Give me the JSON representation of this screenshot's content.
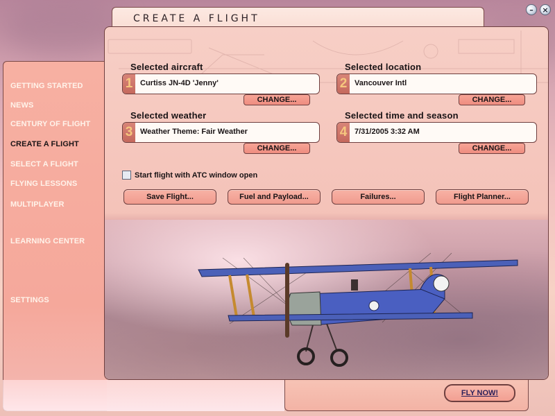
{
  "window": {
    "title": "CREATE A FLIGHT",
    "minimize_glyph": "–",
    "close_glyph": "×"
  },
  "nav": {
    "items": [
      {
        "label": "GETTING STARTED",
        "active": false
      },
      {
        "label": "NEWS",
        "active": false
      },
      {
        "label": "CENTURY OF FLIGHT",
        "active": false
      },
      {
        "label": "CREATE A FLIGHT",
        "active": true
      },
      {
        "label": "SELECT A FLIGHT",
        "active": false
      },
      {
        "label": "FLYING LESSONS",
        "active": false
      },
      {
        "label": "MULTIPLAYER",
        "active": false
      },
      {
        "label": "LEARNING CENTER",
        "active": false
      },
      {
        "label": "SETTINGS",
        "active": false
      }
    ]
  },
  "aircraft": {
    "label": "Selected aircraft",
    "number": "1",
    "value": "Curtiss JN-4D 'Jenny'",
    "change": "CHANGE..."
  },
  "location": {
    "label": "Selected location",
    "number": "2",
    "value": "Vancouver Intl",
    "change": "CHANGE..."
  },
  "weather": {
    "label": "Selected weather",
    "number": "3",
    "value": "Weather Theme: Fair Weather",
    "change": "CHANGE..."
  },
  "time": {
    "label": "Selected time and season",
    "number": "4",
    "value": "7/31/2005 3:32 AM",
    "change": "CHANGE..."
  },
  "atc": {
    "label": "Start flight with ATC window open",
    "checked": false
  },
  "actions": {
    "save": "Save Flight...",
    "fuel": "Fuel and Payload...",
    "failures": "Failures...",
    "planner": "Flight Planner..."
  },
  "fly_now": "FLY NOW!",
  "colors": {
    "panel_bg": "#f4c2b8",
    "border": "#6e3f3f",
    "number_badge": "#c5695d",
    "number_text": "#f6c77e",
    "button": "#f09b8e",
    "aircraft_fuselage": "#4a5fc1"
  }
}
